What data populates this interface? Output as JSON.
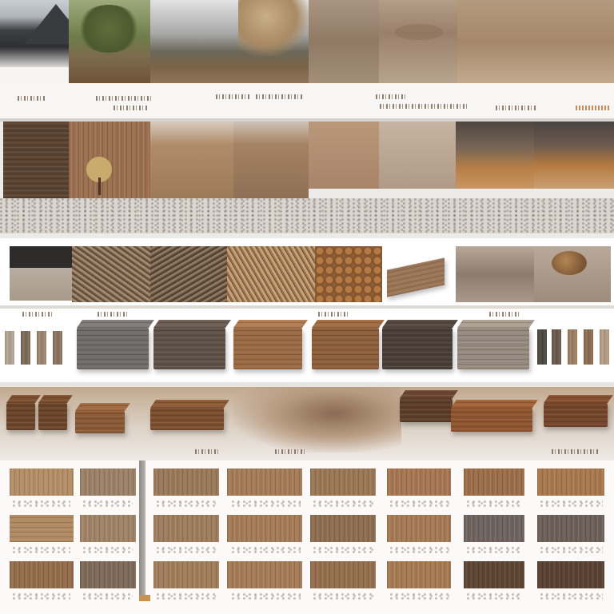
{
  "colors": {
    "background": "#f4f3f1",
    "wood_light": "#b08a64",
    "wood_mid": "#8d6647",
    "wood_dark": "#5a4436",
    "grey_wood": "#6f6a66",
    "sand": "#c9ab8a"
  },
  "rows": [
    {
      "name": "landscape-row",
      "tiles": [
        "mountain-photo",
        "tree-field-photo",
        "misty-field-photo",
        "sand-dune-photo",
        "sand-dune-photo-2",
        "sand-dune-photo-3"
      ]
    },
    {
      "name": "texture-row",
      "tiles": [
        "bark-texture",
        "lone-tree-photo",
        "brown-field",
        "brown-field-2",
        "dry-grass",
        "sand-surface",
        "dry-brush",
        "dry-brush-2"
      ]
    },
    {
      "name": "material-row",
      "tiles": [
        "dark-slab",
        "dry-twigs",
        "twig-pile",
        "straw-pile",
        "wood-chips",
        "wood-plank",
        "grey-sand",
        "walnut"
      ]
    },
    {
      "name": "block-row",
      "tiles": [
        "grey-block",
        "dark-block",
        "light-wood-block",
        "oak-block",
        "charcoal-block",
        "pale-block"
      ]
    },
    {
      "name": "plank-row",
      "tiles": [
        "short-planks",
        "long-plank",
        "wood-beam",
        "dark-beam",
        "oak-beam",
        "walnut-beam"
      ]
    },
    {
      "name": "swatch-grid",
      "tiles": [
        "wood-swatch"
      ]
    }
  ]
}
